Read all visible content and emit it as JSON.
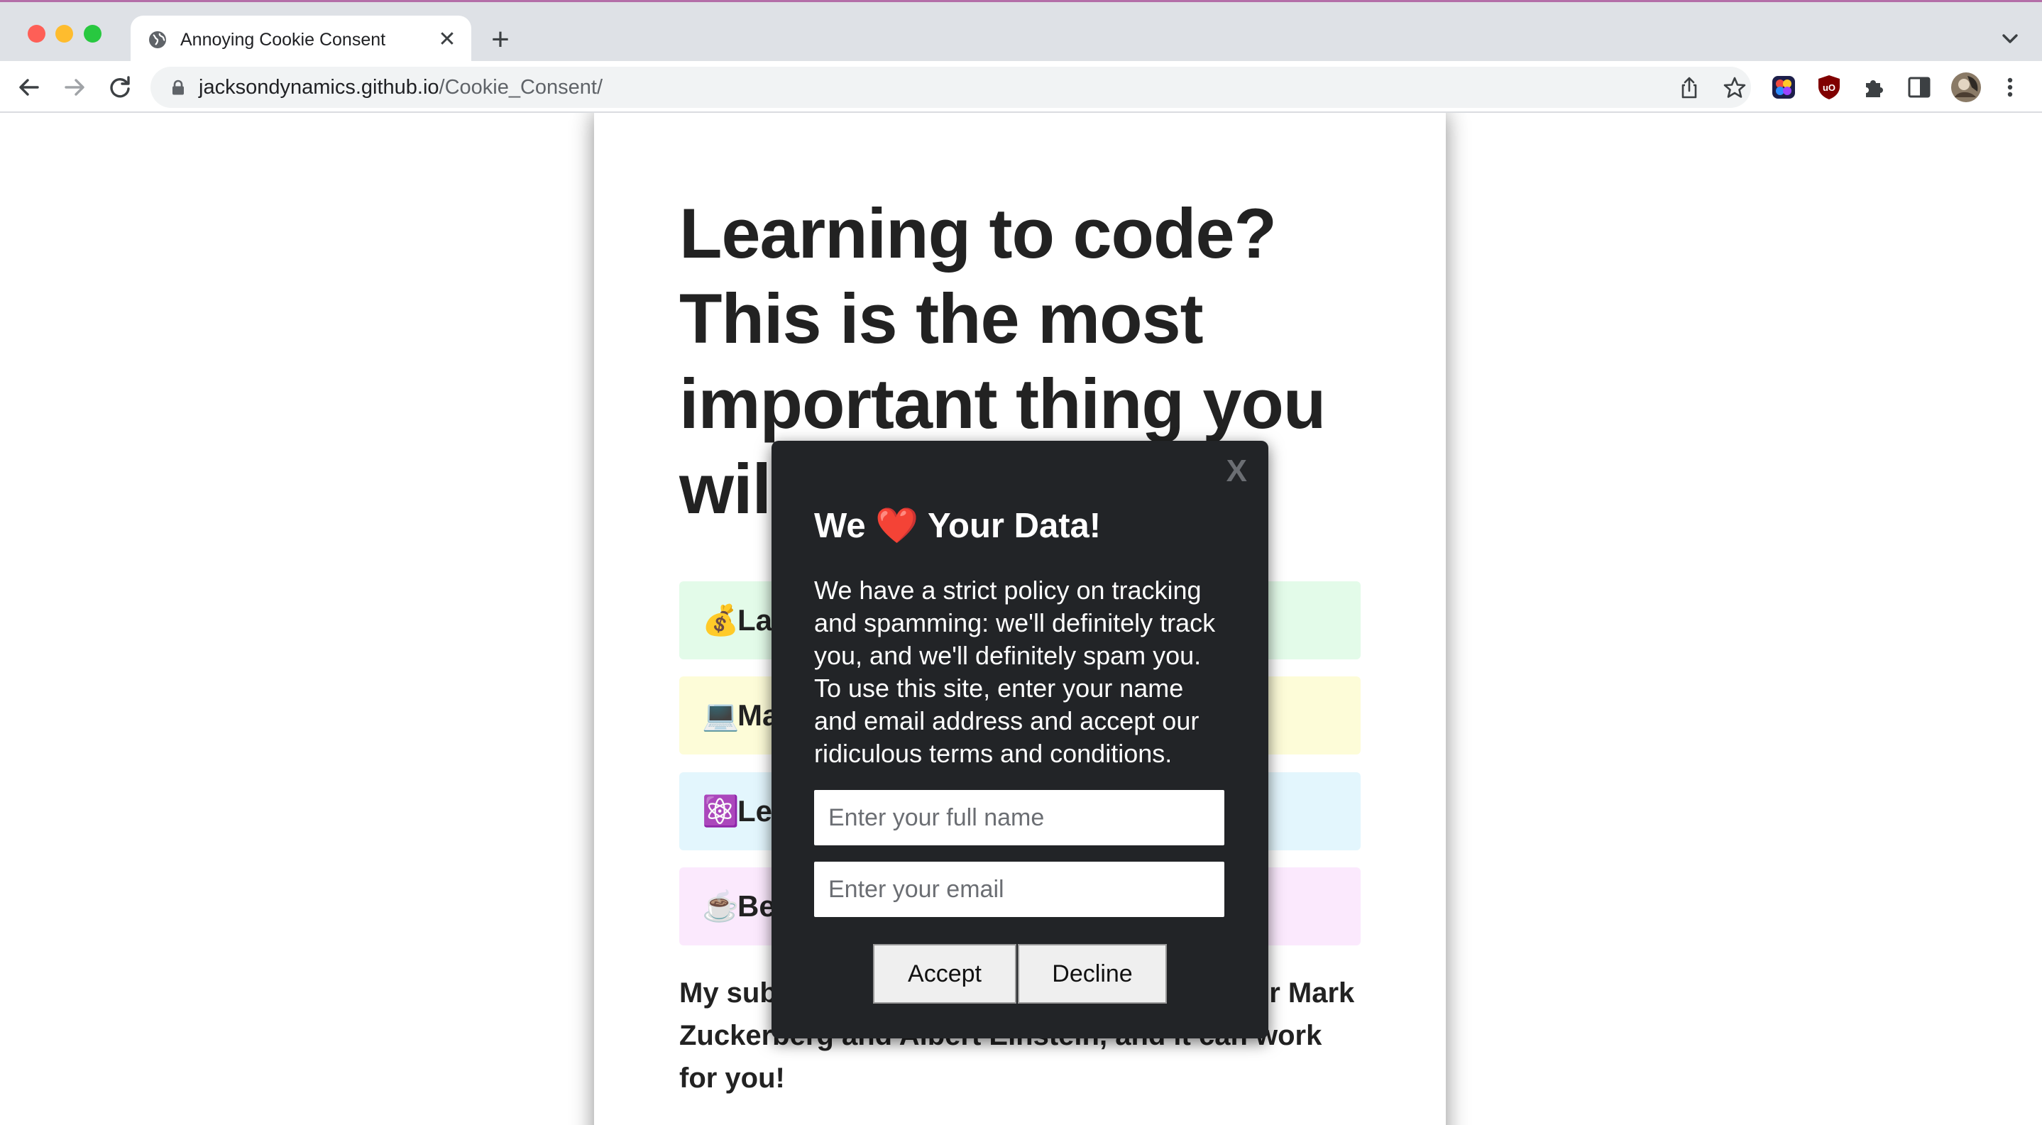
{
  "browser": {
    "tab_title": "Annoying Cookie Consent",
    "tab_close_glyph": "✕",
    "new_tab_glyph": "+",
    "url_host": "jacksondynamics.github.io",
    "url_path": "/Cookie_Consent/",
    "icons": [
      "back-icon",
      "forward-icon",
      "reload-icon",
      "lock-icon",
      "share-icon",
      "bookmark-star-icon",
      "extension-icon",
      "ublock-icon",
      "puzzle-icon",
      "side-panel-icon",
      "profile-avatar",
      "kebab-menu-icon"
    ],
    "colors": {
      "tab_strip": "#dee1e6",
      "close_red": "#fe5f57",
      "minimize_yellow": "#febc2e",
      "maximize_green": "#28c840"
    }
  },
  "page": {
    "headline": "Learning to code? This is the most important thing you will read",
    "features": [
      {
        "emoji": "💰",
        "text": "La",
        "color": "#e3fbe9"
      },
      {
        "emoji": "💻",
        "text": "Ma",
        "color": "#fdfcd8"
      },
      {
        "emoji": "⚛️",
        "text": "Le",
        "color": "#e3f6fd"
      },
      {
        "emoji": "☕",
        "text": "Be",
        "color": "#fbe9fd"
      }
    ],
    "tagline": "My subliminal learning technique worked for Mark Zuckerberg and Albert Einstein, and it can work for you!"
  },
  "modal": {
    "close_label": "X",
    "title_prefix": "We",
    "title_heart": "❤️",
    "title_suffix": "Your Data!",
    "body": "We have a strict policy on tracking and spamming: we'll definitely track you, and we'll definitely spam you. To use this site, enter your name and email address and accept our ridiculous terms and conditions.",
    "name_placeholder": "Enter your full name",
    "email_placeholder": "Enter your email",
    "accept_label": "Accept",
    "decline_label": "Decline",
    "background_color": "#222427"
  }
}
